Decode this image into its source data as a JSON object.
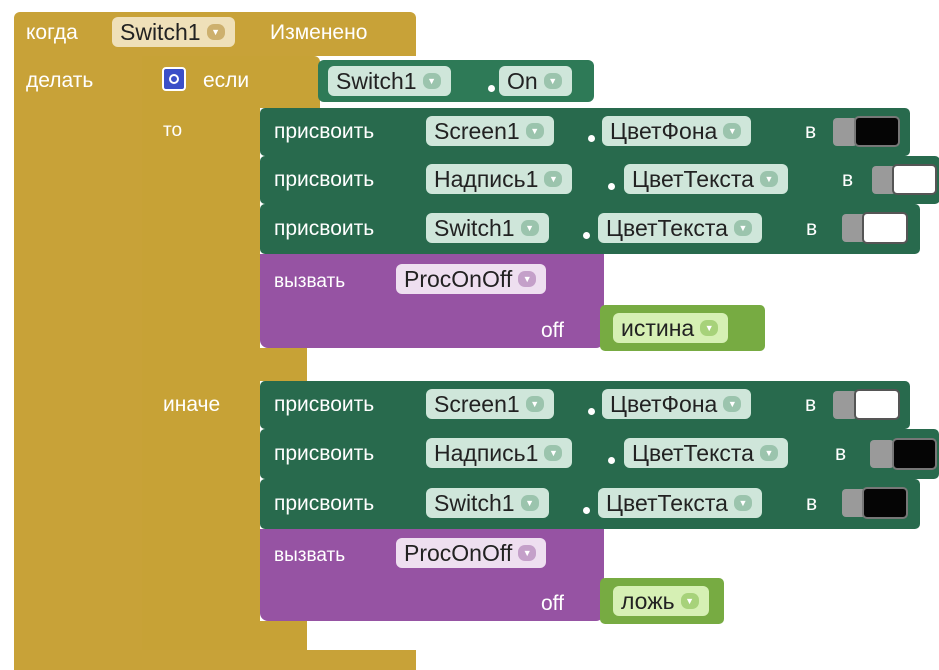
{
  "event": {
    "when_label": "когда",
    "component": "Switch1",
    "event_name": "Изменено",
    "do_label": "делать"
  },
  "if_block": {
    "if_label": "если",
    "condition_component": "Switch1",
    "condition_property": "On",
    "then_label": "то",
    "else_label": "иначе"
  },
  "then_statements": [
    {
      "set_label": "присвоить",
      "component": "Screen1",
      "property": "ЦветФона",
      "to_label": "в",
      "color_value": "black"
    },
    {
      "set_label": "присвоить",
      "component": "Надпись1",
      "property": "ЦветТекста",
      "to_label": "в",
      "color_value": "white"
    },
    {
      "set_label": "присвоить",
      "component": "Switch1",
      "property": "ЦветТекста",
      "to_label": "в",
      "color_value": "white"
    }
  ],
  "then_call": {
    "call_label": "вызвать",
    "procedure": "ProcOnOff",
    "arg_name": "off",
    "arg_value": "истина"
  },
  "else_statements": [
    {
      "set_label": "присвоить",
      "component": "Screen1",
      "property": "ЦветФона",
      "to_label": "в",
      "color_value": "white"
    },
    {
      "set_label": "присвоить",
      "component": "Надпись1",
      "property": "ЦветТекста",
      "to_label": "в",
      "color_value": "black"
    },
    {
      "set_label": "присвоить",
      "component": "Switch1",
      "property": "ЦветТекста",
      "to_label": "в",
      "color_value": "black"
    }
  ],
  "else_call": {
    "call_label": "вызвать",
    "procedure": "ProcOnOff",
    "arg_name": "off",
    "arg_value": "ложь"
  },
  "colors": {
    "event_block": "#c8a238",
    "control_block": "#c7a236",
    "setter_block": "#286a4d",
    "getter_block": "#2e7a57",
    "procedure_block": "#9653a3",
    "logic_block": "#77ab42",
    "mutator_icon": "#3b4fc8"
  },
  "icons": {
    "dropdown": "triangle-down-icon",
    "mutator": "gear-icon"
  }
}
